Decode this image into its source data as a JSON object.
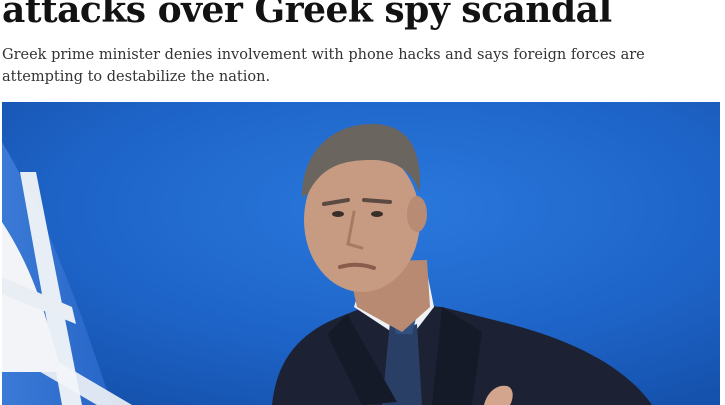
{
  "article": {
    "headline": "attacks over Greek spy scandal",
    "standfirst": "Greek prime minister denies involvement with phone hacks and says foreign forces are attempting to destabilize the nation."
  },
  "photo": {
    "subject": "man-in-suit-speaking",
    "colors": {
      "background": "#1e64c8",
      "flag_blue": "#2f6fd0",
      "flag_white": "#f2f4f8",
      "suit": "#1c2233",
      "tie": "#2a3f66",
      "shirt": "#eef1f5",
      "skin": "#c79a82",
      "hair": "#6b6560"
    }
  }
}
